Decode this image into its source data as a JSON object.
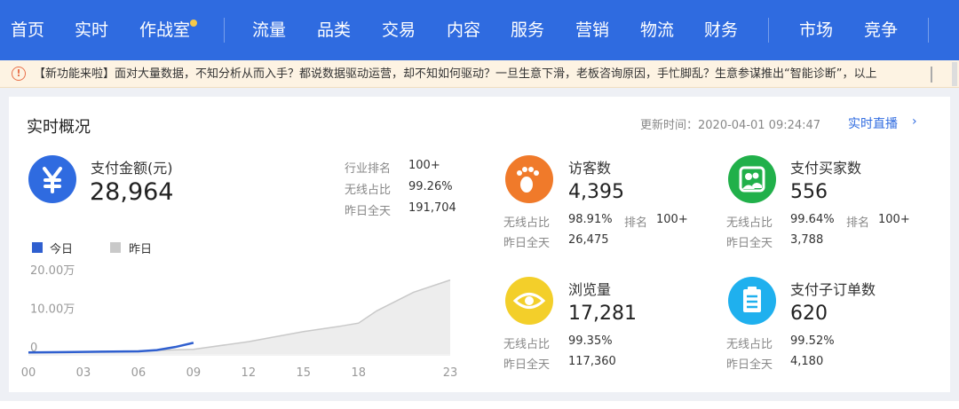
{
  "nav": {
    "items": [
      "首页",
      "实时",
      "作战室",
      "流量",
      "品类",
      "交易",
      "内容",
      "服务",
      "营销",
      "物流",
      "财务",
      "市场",
      "竞争"
    ],
    "active_index": 0,
    "colors": {
      "bg": "#2f6be0",
      "dot": "#f7c948"
    }
  },
  "notice": {
    "icon": "alert-circle-icon",
    "text": "【新功能来啦】面对大量数据，不知分析从而入手？都说数据驱动运营，却不知如何驱动？一旦生意下滑，老板咨询原因，手忙脚乱？生意参谋推出“智能诊断”，以上"
  },
  "overview": {
    "title": "实时概况",
    "update_time": "更新时间：2020-04-01 09:24:47",
    "live_link": "实时直播",
    "live_chevron": "›"
  },
  "payment": {
    "icon": "yen-icon",
    "label": "支付金额(元)",
    "value": "28,964",
    "stats": [
      {
        "key": "行业排名",
        "value": "100+"
      },
      {
        "key": "无线占比",
        "value": "99.26%"
      },
      {
        "key": "昨日全天",
        "value": "191,704"
      }
    ]
  },
  "chart_legend": {
    "today": "今日",
    "yesterday": "昨日"
  },
  "metrics": {
    "visitors": {
      "icon": "footprint-icon",
      "color": "#f07a2a",
      "label": "访客数",
      "value": "4,395",
      "wireless_key": "无线占比",
      "wireless": "98.91%",
      "rank_key": "排名",
      "rank": "100+",
      "yesterday_key": "昨日全天",
      "yesterday": "26,475"
    },
    "buyers": {
      "icon": "users-icon",
      "color": "#21b04a",
      "label": "支付买家数",
      "value": "556",
      "wireless_key": "无线占比",
      "wireless": "99.64%",
      "rank_key": "排名",
      "rank": "100+",
      "yesterday_key": "昨日全天",
      "yesterday": "3,788"
    },
    "pageviews": {
      "icon": "eye-icon",
      "color": "#f3cf2a",
      "label": "浏览量",
      "value": "17,281",
      "wireless_key": "无线占比",
      "wireless": "99.35%",
      "yesterday_key": "昨日全天",
      "yesterday": "117,360"
    },
    "orders": {
      "icon": "clipboard-icon",
      "color": "#1fb0ee",
      "label": "支付子订单数",
      "value": "620",
      "wireless_key": "无线占比",
      "wireless": "99.52%",
      "yesterday_key": "昨日全天",
      "yesterday": "4,180"
    }
  },
  "chart_data": {
    "type": "area",
    "y_ticks": [
      "20.00万",
      "10.00万",
      "0"
    ],
    "x_ticks": [
      "00",
      "03",
      "06",
      "09",
      "12",
      "15",
      "18",
      "23"
    ],
    "ylim": [
      0,
      200000
    ],
    "series": [
      {
        "name": "今日",
        "color": "#2f5fcf",
        "x": [
          0,
          2,
          4,
          6,
          7,
          8,
          9
        ],
        "values": [
          4000,
          5000,
          6000,
          7000,
          10000,
          18000,
          28964
        ]
      },
      {
        "name": "昨日",
        "color": "#c9c9c9",
        "x": [
          0,
          3,
          6,
          9,
          12,
          15,
          17,
          18,
          19,
          21,
          23
        ],
        "values": [
          4000,
          6000,
          8000,
          12000,
          32000,
          58000,
          72000,
          80000,
          112000,
          160000,
          191704
        ]
      }
    ]
  }
}
